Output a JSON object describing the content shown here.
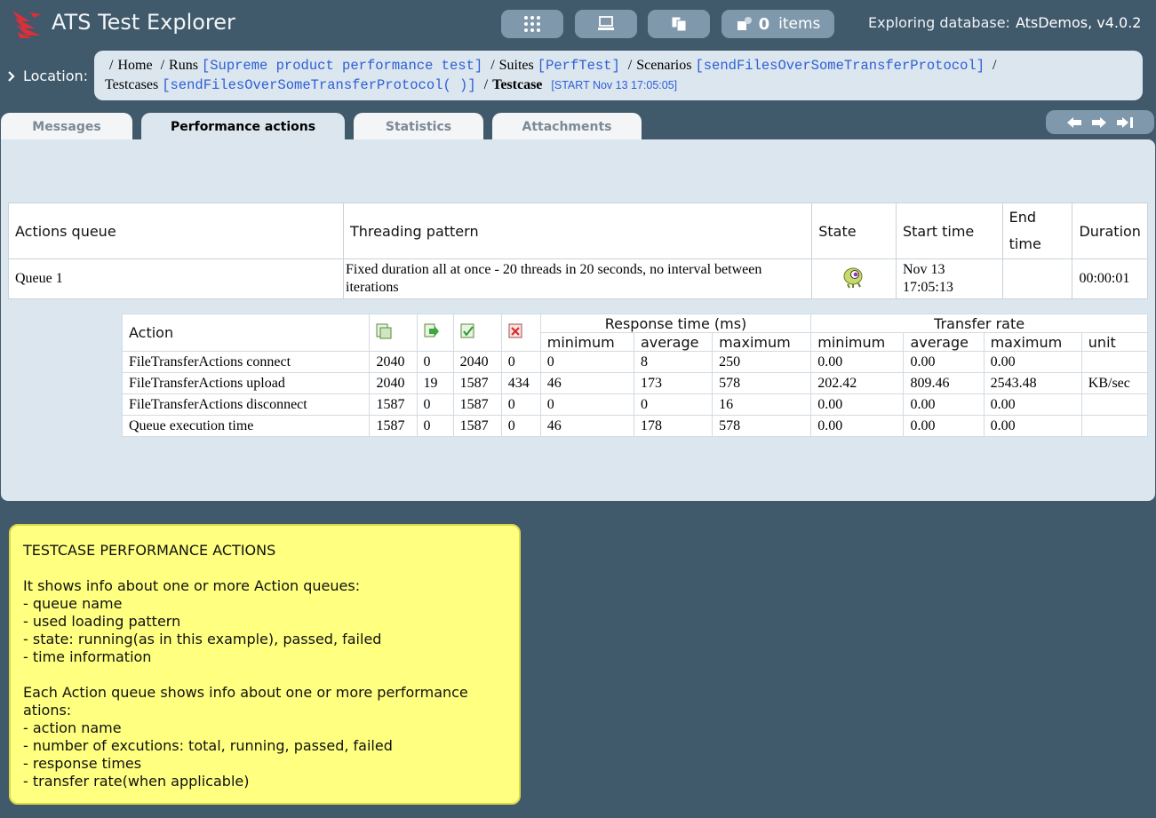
{
  "header": {
    "app_title": "ATS Test Explorer",
    "items_count": "0",
    "items_label": "items",
    "db_label": "Exploring database:",
    "db_name": "AtsDemos, v4.0.2"
  },
  "location": {
    "label": "Location:",
    "crumbs": {
      "home": "Home",
      "runs": "Runs",
      "run_name": "[Supreme product performance test]",
      "suites": "Suites",
      "suite_name": "[PerfTest]",
      "scenarios": "Scenarios",
      "scenario_name": "[sendFilesOverSomeTransferProtocol]",
      "testcases": "Testcases",
      "testcase_name": "[sendFilesOverSomeTransferProtocol( )]",
      "testcase": "Testcase",
      "start": "[START Nov 13 17:05:05]"
    }
  },
  "tabs": {
    "messages": "Messages",
    "performance": "Performance actions",
    "statistics": "Statistics",
    "attachments": "Attachments"
  },
  "queue_table": {
    "headers": {
      "queue": "Actions queue",
      "pattern": "Threading pattern",
      "state": "State",
      "start": "Start time",
      "end": "End time",
      "duration": "Duration"
    },
    "row": {
      "queue": "Queue 1",
      "pattern": "Fixed duration all at once - 20 threads in 20 seconds, no interval between iterations",
      "start_line1": "Nov 13",
      "start_line2": "17:05:13",
      "end": "",
      "duration": "00:00:01"
    }
  },
  "actions_table": {
    "headers": {
      "action": "Action",
      "response_group": "Response time (ms)",
      "transfer_group": "Transfer rate",
      "min": "minimum",
      "avg": "average",
      "max": "maximum",
      "unit": "unit"
    },
    "rows": [
      {
        "name": "FileTransferActions connect",
        "total": "2040",
        "running": "0",
        "passed": "2040",
        "failed": "0",
        "rmin": "0",
        "ravg": "8",
        "rmax": "250",
        "tmin": "0.00",
        "tavg": "0.00",
        "tmax": "0.00",
        "unit": ""
      },
      {
        "name": "FileTransferActions upload",
        "total": "2040",
        "running": "19",
        "passed": "1587",
        "failed": "434",
        "rmin": "46",
        "ravg": "173",
        "rmax": "578",
        "tmin": "202.42",
        "tavg": "809.46",
        "tmax": "2543.48",
        "unit": "KB/sec"
      },
      {
        "name": "FileTransferActions disconnect",
        "total": "1587",
        "running": "0",
        "passed": "1587",
        "failed": "0",
        "rmin": "0",
        "ravg": "0",
        "rmax": "16",
        "tmin": "0.00",
        "tavg": "0.00",
        "tmax": "0.00",
        "unit": ""
      },
      {
        "name": "Queue execution time",
        "total": "1587",
        "running": "0",
        "passed": "1587",
        "failed": "0",
        "rmin": "46",
        "ravg": "178",
        "rmax": "578",
        "tmin": "0.00",
        "tavg": "0.00",
        "tmax": "0.00",
        "unit": ""
      }
    ]
  },
  "note": {
    "text": "TESTCASE PERFORMANCE ACTIONS\n\nIt shows info about one or more Action queues:\n- queue name\n- used loading pattern\n- state: running(as in this example), passed, failed\n- time information\n\nEach Action queue shows info about one or more performance ations:\n- action name\n- number of excutions: total, running, passed, failed\n- response times\n- transfer rate(when applicable)"
  },
  "colors": {
    "background": "#40596b",
    "panel": "#dbe6ee",
    "button": "#7f98ab",
    "link": "#2e5fd6",
    "note": "#ffff80",
    "logo": "#d9303a"
  }
}
